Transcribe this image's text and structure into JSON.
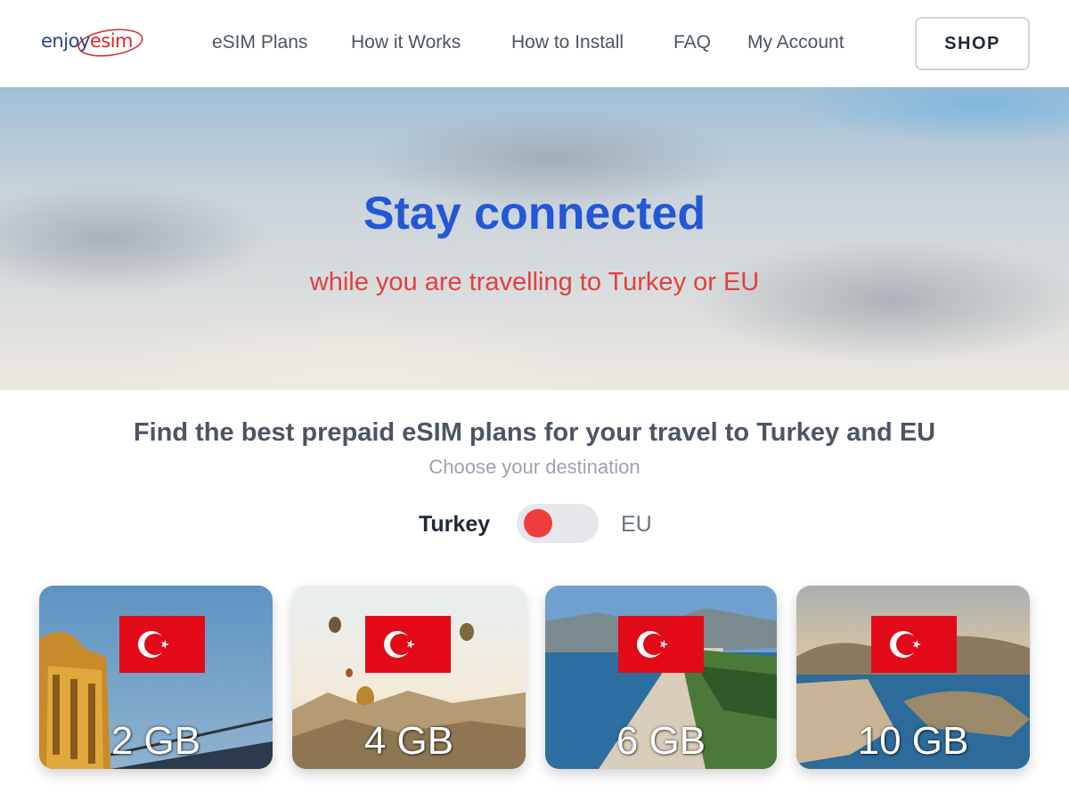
{
  "header": {
    "logo": {
      "part1": "enjoy",
      "part2": "esim"
    },
    "nav": [
      {
        "label": "eSIM Plans"
      },
      {
        "label": "How it Works"
      },
      {
        "label": "How to Install"
      },
      {
        "label": "FAQ"
      },
      {
        "label": "My Account"
      }
    ],
    "shop_label": "SHOP"
  },
  "hero": {
    "title": "Stay connected",
    "subtitle": "while you are travelling to Turkey or EU"
  },
  "plans_section": {
    "title": "Find the best prepaid eSIM plans for your travel to Turkey and EU",
    "subtitle": "Choose your destination",
    "toggle": {
      "left_label": "Turkey",
      "right_label": "EU",
      "selected": "Turkey"
    },
    "cards": [
      {
        "data": "2 GB",
        "flag_icon": "turkey-flag-icon"
      },
      {
        "data": "4 GB",
        "flag_icon": "turkey-flag-icon"
      },
      {
        "data": "6 GB",
        "flag_icon": "turkey-flag-icon"
      },
      {
        "data": "10 GB",
        "flag_icon": "turkey-flag-icon"
      }
    ]
  },
  "colors": {
    "hero_title": "#2457d6",
    "hero_subtitle": "#e0413f",
    "toggle_knob": "#ef3d3d",
    "flag_red": "#e30a17"
  }
}
